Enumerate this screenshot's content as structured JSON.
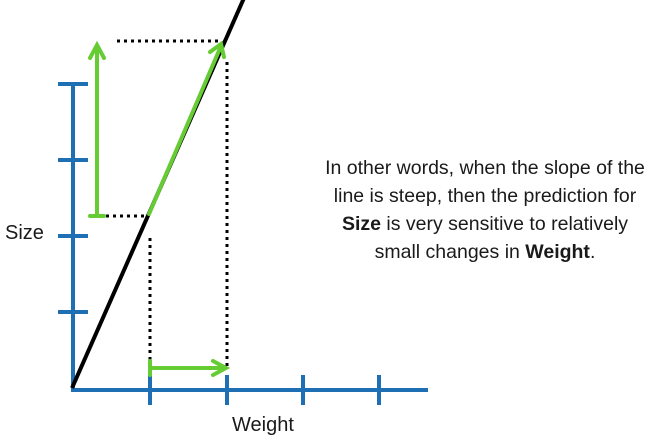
{
  "colors": {
    "axis": "#1f6fb5",
    "line": "#000000",
    "highlight": "#66cc33",
    "guides": "#000000"
  },
  "diagram": {
    "y_axis_label": "Size",
    "x_axis_label": "Weight",
    "y_ticks": 4,
    "x_ticks": 4
  },
  "explanation": {
    "part1": "In other words, when the slope of the line is steep, then the prediction for ",
    "bold1": "Size",
    "part2": " is very sensitive to relatively small changes in ",
    "bold2": "Weight",
    "part3": "."
  }
}
